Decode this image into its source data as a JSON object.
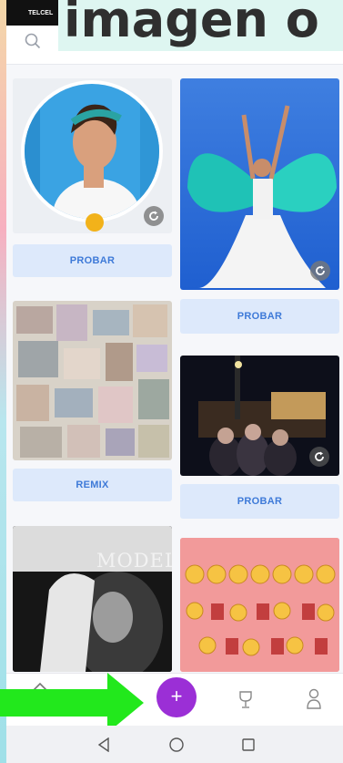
{
  "status": {
    "carrier": "TELCEL"
  },
  "overlay": {
    "title": "imagen o"
  },
  "feed": {
    "cards": [
      {
        "label": "PROBAR"
      },
      {
        "label": "PROBAR"
      },
      {
        "label": "REMIX"
      },
      {
        "label": "PROBAR"
      },
      {
        "label": ""
      },
      {
        "label": ""
      }
    ],
    "model_text": "MODEL"
  },
  "nav": {
    "items": [
      "home-icon",
      "add-icon",
      "trophy-icon",
      "profile-icon"
    ],
    "add_label": "+"
  },
  "colors": {
    "accent": "#9b2fd6",
    "button_bg": "#dde9fb",
    "button_text": "#3e7ad8",
    "arrow": "#22e81c"
  }
}
